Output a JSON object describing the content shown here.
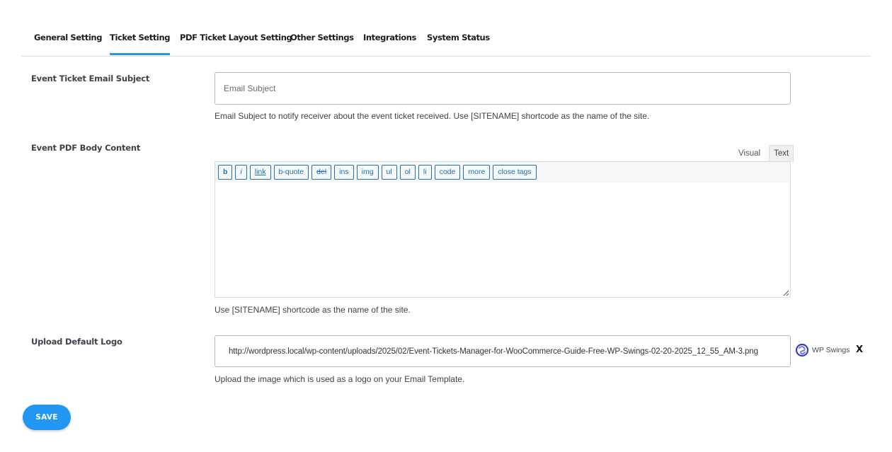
{
  "tabs": [
    {
      "label": "General Setting",
      "active": false
    },
    {
      "label": "Ticket Setting",
      "active": true
    },
    {
      "label": "PDF Ticket Layout Setting",
      "active": false
    },
    {
      "label": "Other Settings",
      "active": false
    },
    {
      "label": "Integrations",
      "active": false
    },
    {
      "label": "System Status",
      "active": false
    }
  ],
  "email_subject": {
    "label": "Event Ticket Email Subject",
    "placeholder": "Email Subject",
    "value": "",
    "description": "Email Subject to notify receiver about the event ticket received. Use [SITENAME] shortcode as the name of the site."
  },
  "pdf_body": {
    "label": "Event PDF Body Content",
    "editor_tabs": {
      "visual": "Visual",
      "text": "Text",
      "active": "text"
    },
    "quicktags": [
      "b",
      "i",
      "link",
      "b-quote",
      "del",
      "ins",
      "img",
      "ul",
      "ol",
      "li",
      "code",
      "more",
      "close tags"
    ],
    "content": "",
    "description": "Use [SITENAME] shortcode as the name of the site."
  },
  "logo": {
    "label": "Upload Default Logo",
    "value": "http://wordpress.local/wp-content/uploads/2025/02/Event-Tickets-Manager-for-WooCommerce-Guide-Free-WP-Swings-02-20-2025_12_55_AM-3.png",
    "preview_text": "WP Swings",
    "remove_label": "X",
    "description": "Upload the image which is used as a logo on your Email Template."
  },
  "actions": {
    "save_label": "SAVE"
  },
  "colors": {
    "accent": "#2196f3",
    "quicktag": "#2271b1",
    "logo_mark": "#3b3fbf"
  }
}
